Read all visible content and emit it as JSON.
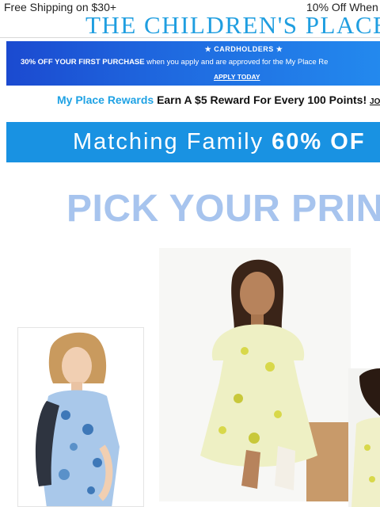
{
  "topbar": {
    "left_text": "Free Shipping on $30+",
    "right_text": "10% Off When"
  },
  "logo": {
    "text": "THE CHILDREN'S PLACE"
  },
  "promo": {
    "kicker": "★ CARDHOLDERS ★",
    "offer_bold": "30% OFF YOUR FIRST PURCHASE",
    "offer_rest": " when you apply and are approved for the My Place Re",
    "cta": "APPLY TODAY",
    "colors": {
      "start": "#1b4ad0",
      "end": "#2389ee"
    }
  },
  "rewards": {
    "brand": "My Place Rewards",
    "message": "Earn A $5 Reward For Every 100 Points!",
    "join": "JO"
  },
  "family_banner": {
    "text": "Matching Family ",
    "highlight": "60% OF",
    "color": "#1992e2"
  },
  "headline": {
    "text": "PICK YOUR PRIN",
    "color": "#a7c4ee"
  },
  "images": [
    {
      "name": "girl-blue-floral-dress",
      "colors": {
        "dress": "#a9c8ea",
        "pattern": "#3e78b8"
      }
    },
    {
      "name": "girl-yellow-floral-dress",
      "colors": {
        "dress": "#eef0c4",
        "pattern": "#d8d84a"
      }
    },
    {
      "name": "girl-partial-right",
      "colors": {
        "dress": "#f0f0c8"
      }
    }
  ]
}
